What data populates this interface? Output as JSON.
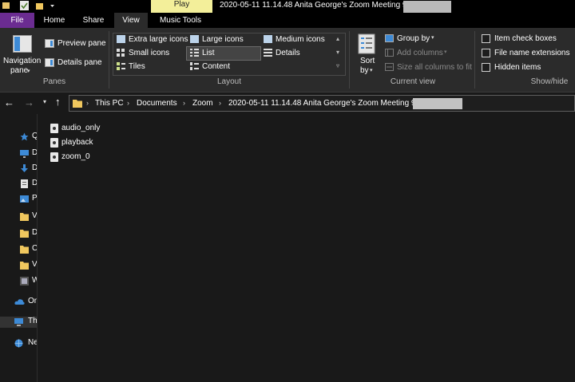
{
  "titlebar": {
    "contextual_tab": "Play",
    "window_title": "2020-05-11 11.14.48 Anita George's Zoom Meeting 9"
  },
  "tabs": [
    "File",
    "Home",
    "Share",
    "View",
    "Music Tools"
  ],
  "ribbon": {
    "panes": {
      "navigation_pane": "Navigation",
      "navigation_pane_2": "pane",
      "preview_pane": "Preview pane",
      "details_pane": "Details pane",
      "label": "Panes"
    },
    "layout": {
      "extra_large": "Extra large icons",
      "large": "Large icons",
      "medium": "Medium icons",
      "small": "Small icons",
      "list": "List",
      "details": "Details",
      "tiles": "Tiles",
      "content": "Content",
      "label": "Layout"
    },
    "current_view": {
      "sort_by": "Sort",
      "sort_by_2": "by",
      "group_by": "Group by",
      "add_columns": "Add columns",
      "size_all": "Size all columns to fit",
      "label": "Current view"
    },
    "show_hide": {
      "item_check_boxes": "Item check boxes",
      "file_name_extensions": "File name extensions",
      "hidden_items": "Hidden items",
      "label": "Show/hide"
    }
  },
  "address": {
    "crumbs": [
      "This PC",
      "Documents",
      "Zoom",
      "2020-05-11 11.14.48 Anita George's Zoom Meeting 9"
    ]
  },
  "nav_pane": {
    "items": [
      {
        "label": "Q",
        "icon": "star-icon"
      },
      {
        "label": "D",
        "icon": "desktop-icon"
      },
      {
        "label": "D",
        "icon": "download-icon"
      },
      {
        "label": "D",
        "icon": "document-icon"
      },
      {
        "label": "P",
        "icon": "pictures-icon"
      },
      {
        "label": "V",
        "icon": "folder-icon"
      },
      {
        "label": "D",
        "icon": "folder-icon"
      },
      {
        "label": "C",
        "icon": "folder-icon"
      },
      {
        "label": "V",
        "icon": "folder-icon"
      },
      {
        "label": "W",
        "icon": "video-icon"
      },
      {
        "label": "On",
        "icon": "onedrive-icon"
      },
      {
        "label": "Th",
        "icon": "this-pc-icon"
      },
      {
        "label": "Ne",
        "icon": "network-icon"
      }
    ]
  },
  "files": [
    {
      "name": "audio_only"
    },
    {
      "name": "playback"
    },
    {
      "name": "zoom_0"
    }
  ],
  "colors": {
    "file_tab": "#6b2c91",
    "play_tab": "#f3ef9a",
    "background": "#191919",
    "ribbon": "#2b2b2b"
  }
}
